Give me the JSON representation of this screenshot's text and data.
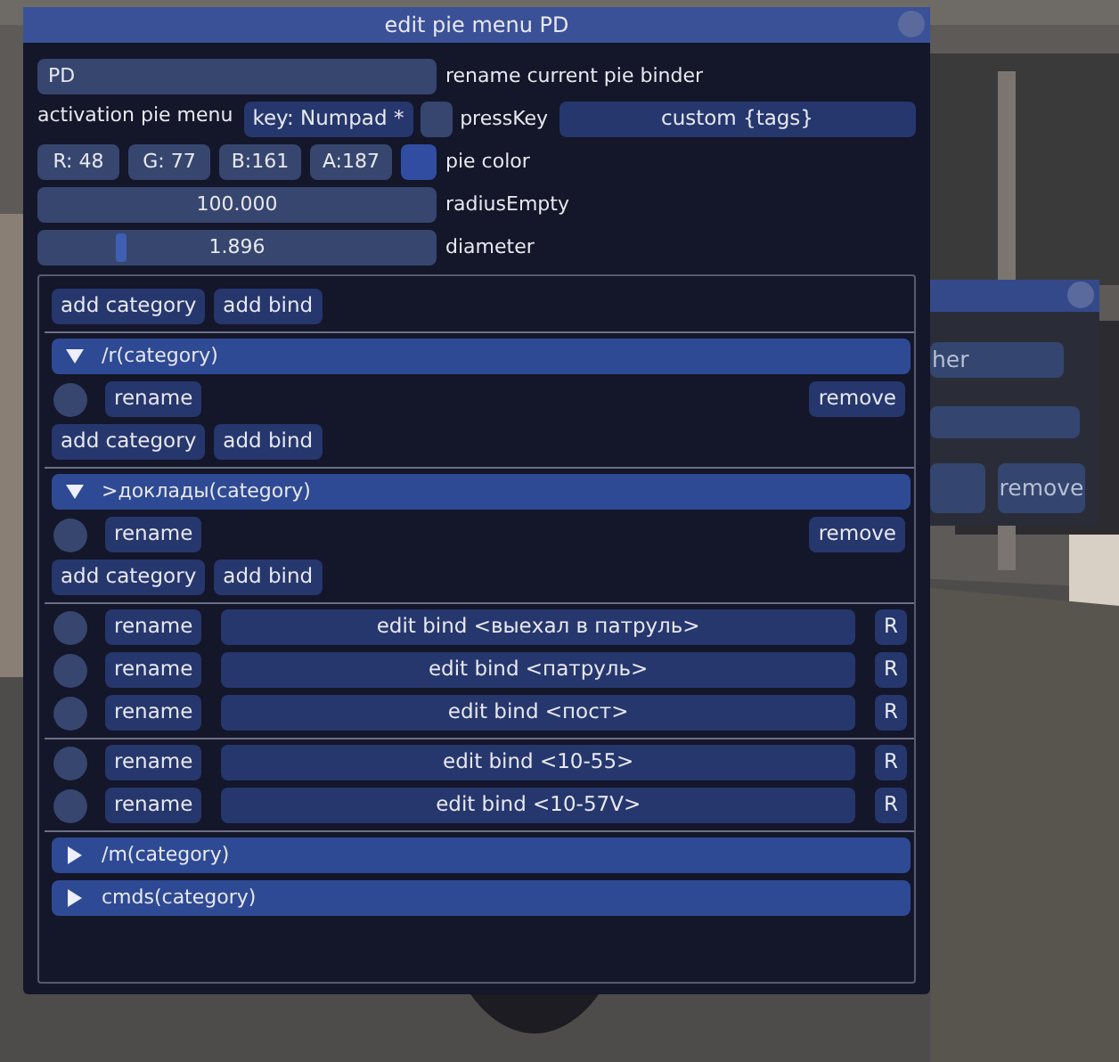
{
  "back_window": {
    "button_text": "her",
    "remove": "remove"
  },
  "window": {
    "title": "edit pie menu PD"
  },
  "name_field": {
    "value": "PD",
    "label": "rename current pie binder"
  },
  "activation": {
    "label": "activation pie menu",
    "key": "key: Numpad *",
    "press_key_checked": false,
    "press_key_label": "pressKey",
    "custom": "custom {tags}"
  },
  "color": {
    "channels": [
      "R: 48",
      "G: 77",
      "B:161",
      "A:187"
    ],
    "label": "pie color"
  },
  "sliders": [
    {
      "value": "100.000",
      "label": "radiusEmpty"
    },
    {
      "value": "1.896",
      "label": "diameter",
      "level": 0.2
    }
  ],
  "rows": [
    {
      "kind": "toolbar",
      "buttons": [
        "add category",
        "add bind"
      ]
    },
    {
      "kind": "separator"
    },
    {
      "kind": "category",
      "label": "/r(category)",
      "expanded": true
    },
    {
      "kind": "actions",
      "selected": false,
      "rename": "rename",
      "remove": "remove"
    },
    {
      "kind": "toolbar",
      "buttons": [
        "add category",
        "add bind"
      ]
    },
    {
      "kind": "separator"
    },
    {
      "kind": "category",
      "label": ">доклады(category)",
      "expanded": true
    },
    {
      "kind": "actions",
      "selected": false,
      "rename": "rename",
      "remove": "remove"
    },
    {
      "kind": "toolbar",
      "buttons": [
        "add category",
        "add bind"
      ]
    },
    {
      "kind": "separator"
    },
    {
      "kind": "bind",
      "selected": false,
      "rename": "rename",
      "edit": "edit bind <выехал в патруль>",
      "r": "R"
    },
    {
      "kind": "bind",
      "selected": false,
      "rename": "rename",
      "edit": "edit bind <патруль>",
      "r": "R"
    },
    {
      "kind": "bind",
      "selected": false,
      "rename": "rename",
      "edit": "edit bind <пост>",
      "r": "R"
    },
    {
      "kind": "separator"
    },
    {
      "kind": "bind",
      "selected": false,
      "rename": "rename",
      "edit": "edit bind <10-55>",
      "r": "R"
    },
    {
      "kind": "bind",
      "selected": false,
      "rename": "rename",
      "edit": "edit bind <10-57V>",
      "r": "R"
    },
    {
      "kind": "separator"
    },
    {
      "kind": "category",
      "label": "/m(category)",
      "expanded": false
    },
    {
      "kind": "category",
      "label": "cmds(category)",
      "expanded": false
    }
  ]
}
